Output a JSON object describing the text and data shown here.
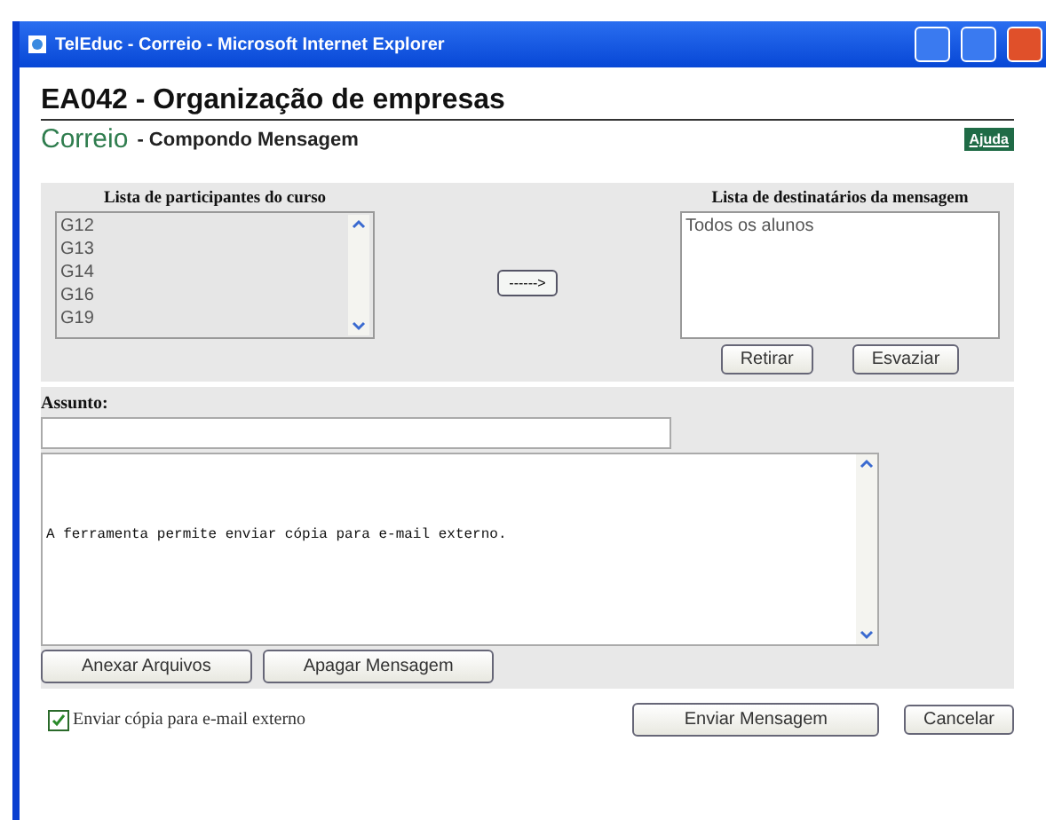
{
  "window": {
    "title": "TelEduc - Correio - Microsoft Internet Explorer"
  },
  "course_title": "EA042 - Organização de empresas",
  "tool": {
    "name": "Correio",
    "subtitle": "- Compondo Mensagem",
    "help": "Ajuda"
  },
  "participants": {
    "label": "Lista de participantes do curso",
    "items": [
      "G12",
      "G13",
      "G14",
      "G16",
      "G19"
    ]
  },
  "move_button": "------>",
  "recipients": {
    "label": "Lista de destinatários da mensagem",
    "items": [
      "Todos os alunos"
    ],
    "buttons": [
      "Retirar",
      "Esvaziar"
    ]
  },
  "subject": {
    "label": "Assunto:"
  },
  "body": {
    "value": "A ferramenta permite enviar cópia para e-mail externo."
  },
  "body_buttons": [
    "Anexar Arquivos",
    "Apagar Mensagem"
  ],
  "external_copy": {
    "label": "Enviar cópia para e-mail externo",
    "checked": true
  },
  "actions": [
    "Enviar Mensagem",
    "Cancelar"
  ]
}
